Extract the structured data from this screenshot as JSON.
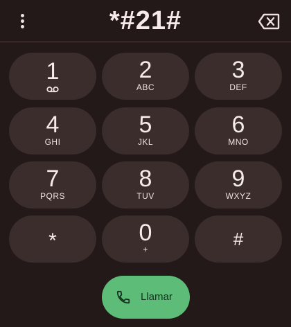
{
  "header": {
    "menu_icon": "more-vert-icon",
    "dialed_number": "*#21#",
    "backspace_icon": "backspace-icon"
  },
  "keypad": {
    "keys": [
      {
        "digit": "1",
        "letters": "",
        "icon": "voicemail-icon"
      },
      {
        "digit": "2",
        "letters": "ABC"
      },
      {
        "digit": "3",
        "letters": "DEF"
      },
      {
        "digit": "4",
        "letters": "GHI"
      },
      {
        "digit": "5",
        "letters": "JKL"
      },
      {
        "digit": "6",
        "letters": "MNO"
      },
      {
        "digit": "7",
        "letters": "PQRS"
      },
      {
        "digit": "8",
        "letters": "TUV"
      },
      {
        "digit": "9",
        "letters": "WXYZ"
      },
      {
        "digit": "*",
        "letters": ""
      },
      {
        "digit": "0",
        "letters": "+"
      },
      {
        "digit": "#",
        "letters": ""
      }
    ]
  },
  "call_button": {
    "label": "Llamar",
    "icon": "phone-icon"
  },
  "colors": {
    "background": "#231918",
    "key_background": "#3a2d2c",
    "call_button": "#5cbc78",
    "text": "#f6ebe9"
  }
}
